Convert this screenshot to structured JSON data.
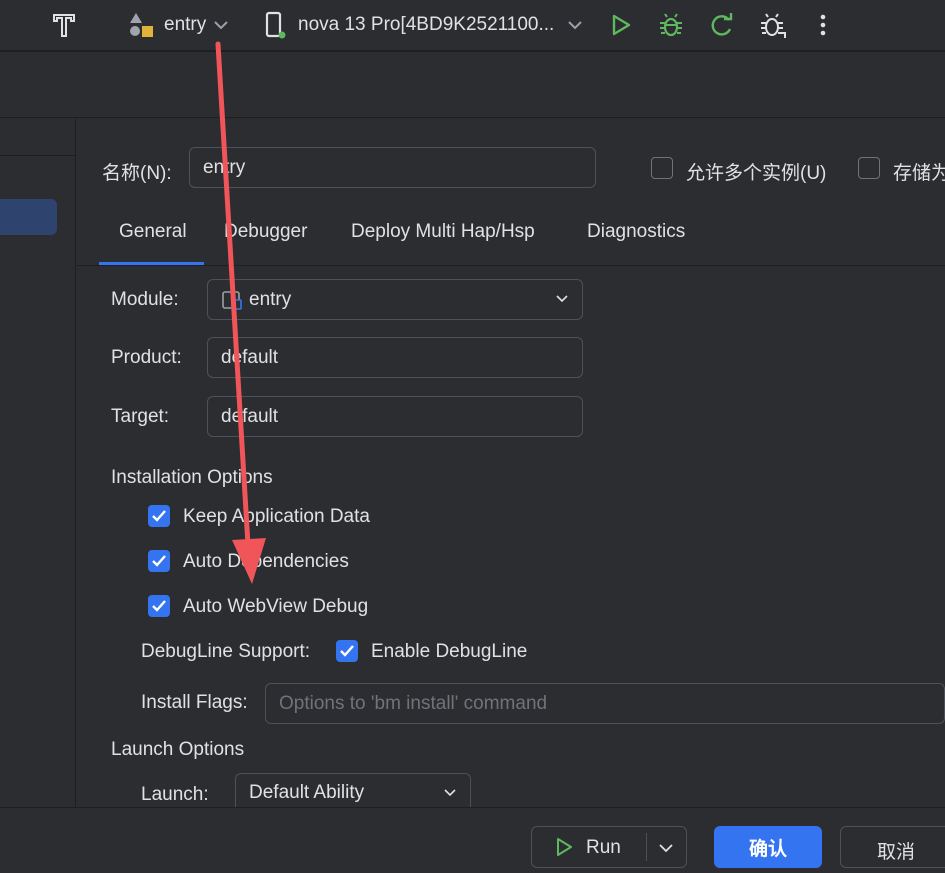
{
  "toolbar": {
    "config_name": "entry",
    "device_name": "nova 13 Pro[4BD9K2521100..."
  },
  "form": {
    "name_label": "名称(N):",
    "name_value": "entry",
    "allow_multiple_label": "允许多个实例(U)",
    "store_as_label": "存储为"
  },
  "tabs": [
    {
      "label": "General"
    },
    {
      "label": "Debugger"
    },
    {
      "label": "Deploy Multi Hap/Hsp"
    },
    {
      "label": "Diagnostics"
    }
  ],
  "general": {
    "module_label": "Module:",
    "module_value": "entry",
    "product_label": "Product:",
    "product_value": "default",
    "target_label": "Target:",
    "target_value": "default",
    "installation_options_title": "Installation Options",
    "keep_app_data_label": "Keep Application Data",
    "auto_dependencies_label": "Auto Dependencies",
    "auto_webview_debug_label": "Auto WebView Debug",
    "debugline_support_label": "DebugLine Support:",
    "enable_debugline_label": "Enable DebugLine",
    "install_flags_label": "Install Flags:",
    "install_flags_placeholder": "Options to 'bm install' command",
    "launch_options_title": "Launch Options",
    "launch_label": "Launch:",
    "launch_value": "Default Ability"
  },
  "footer": {
    "run_label": "Run",
    "ok_label": "确认",
    "cancel_label": "取消"
  },
  "colors": {
    "accent": "#3574f0",
    "annotation_arrow": "#f0555a",
    "run_green": "#5fb85f"
  },
  "checkbox_states": {
    "allow_multiple": false,
    "store_as": false,
    "keep_app_data": true,
    "auto_dependencies": true,
    "auto_webview_debug": true,
    "enable_debugline": true
  }
}
